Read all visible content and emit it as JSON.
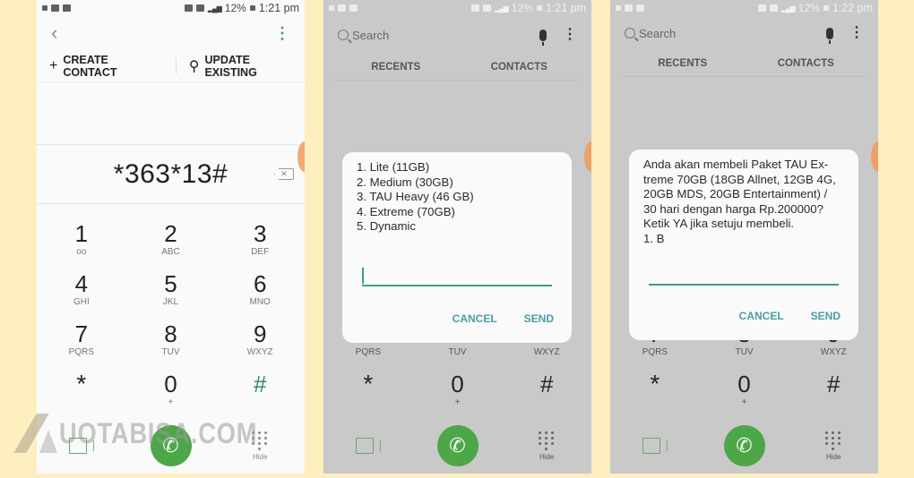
{
  "panels": [
    {
      "status": {
        "left_icons": [
          "data-speed-icon",
          "folder-icon",
          "video-icon"
        ],
        "data_speed": "0",
        "battery": "12%",
        "time": "1:21 pm"
      },
      "header": {
        "back": "‹",
        "more": "⋮"
      },
      "actions": {
        "create_icon": "+",
        "create_label": "CREATE CONTACT",
        "update_icon": "person-icon",
        "update_label": "UPDATE EXISTING"
      },
      "dialed_number": "*363*13#",
      "backspace_glyph": "✕"
    },
    {
      "status": {
        "battery": "12%",
        "time": "1:21 pm"
      },
      "search": {
        "placeholder": "Search"
      },
      "tabs": [
        "RECENTS",
        "CONTACTS"
      ],
      "dialog": {
        "message": "1. Lite (11GB)\n2. Medium (30GB)\n3. TAU Heavy (46 GB)\n4. Extreme (70GB)\n5. Dynamic",
        "input_value": "",
        "cancel": "CANCEL",
        "send": "SEND"
      }
    },
    {
      "status": {
        "battery": "12%",
        "time": "1:22 pm"
      },
      "search": {
        "placeholder": "Search"
      },
      "tabs": [
        "RECENTS",
        "CONTACTS"
      ],
      "dialog": {
        "message": "Anda akan membeli Paket TAU Ex-\ntreme 70GB (18GB Allnet, 12GB 4G,\n20GB MDS, 20GB Entertainment) /\n30 hari dengan harga Rp.200000?\nKetik YA jika setuju membeli.\n1. B",
        "input_value": "",
        "cancel": "CANCEL",
        "send": "SEND"
      }
    }
  ],
  "keypad": [
    [
      {
        "d": "1",
        "l": "ᴏᴏ"
      },
      {
        "d": "2",
        "l": "ABC"
      },
      {
        "d": "3",
        "l": "DEF"
      }
    ],
    [
      {
        "d": "4",
        "l": "GHI"
      },
      {
        "d": "5",
        "l": "JKL"
      },
      {
        "d": "6",
        "l": "MNO"
      }
    ],
    [
      {
        "d": "7",
        "l": "PQRS"
      },
      {
        "d": "8",
        "l": "TUV"
      },
      {
        "d": "9",
        "l": "WXYZ"
      }
    ],
    [
      {
        "d": "*",
        "l": ""
      },
      {
        "d": "0",
        "l": "+"
      },
      {
        "d": "#",
        "l": ""
      }
    ]
  ],
  "bottom": {
    "call_glyph": "✆",
    "hide_label": "Hide"
  },
  "watermark": "UOTABISA.COM",
  "colors": {
    "accent_green": "#4da748",
    "dialog_accent": "#3d9c8c",
    "button_text": "#4a9ea3",
    "background": "#fdefbf"
  }
}
